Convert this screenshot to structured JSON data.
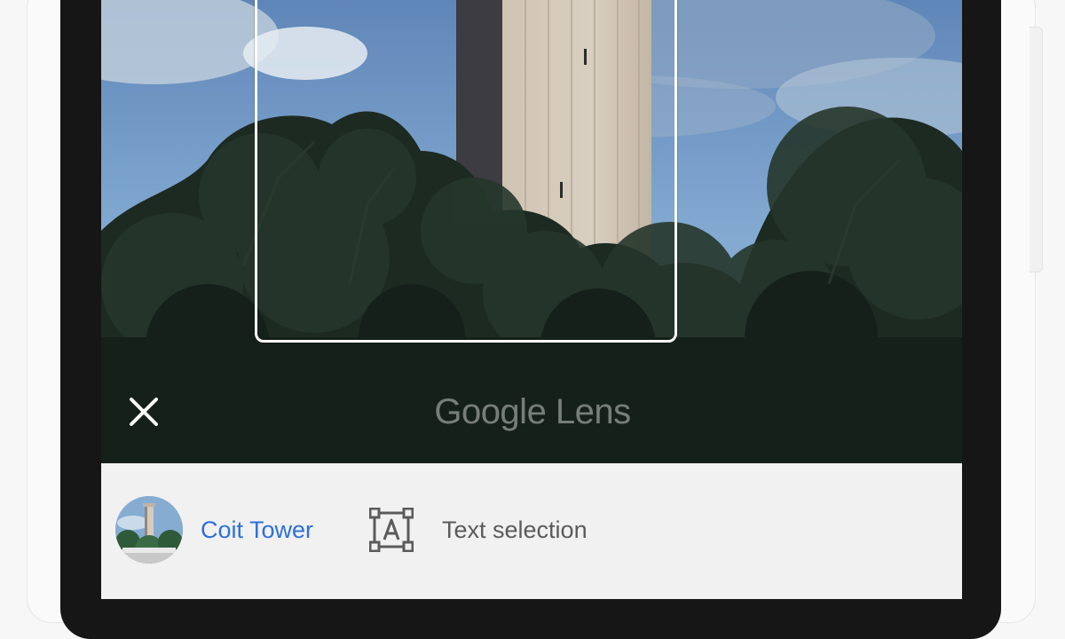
{
  "overlay": {
    "watermark": "Google Lens",
    "close_icon": "close-icon"
  },
  "results": {
    "landmark": {
      "label": "Coit Tower",
      "icon": "landmark-thumbnail"
    },
    "text_selection": {
      "label": "Text selection",
      "icon": "text-selection-icon"
    }
  },
  "colors": {
    "accent_link": "#2f6fdc",
    "sheet_background": "#f1f1f1",
    "secondary_text": "#5b5b5b"
  }
}
